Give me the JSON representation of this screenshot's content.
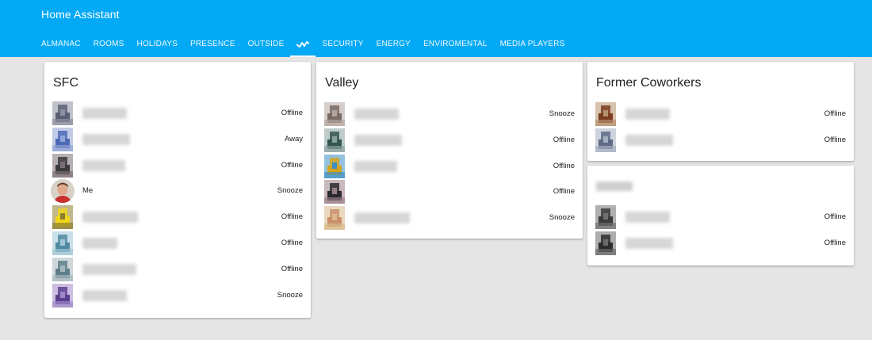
{
  "app": {
    "title": "Home Assistant"
  },
  "tabs": [
    {
      "label": "ALMANAC"
    },
    {
      "label": "ROOMS"
    },
    {
      "label": "HOLIDAYS"
    },
    {
      "label": "PRESENCE"
    },
    {
      "label": "OUTSIDE"
    },
    {
      "label": "",
      "icon": "wave-icon",
      "active": true
    },
    {
      "label": "SECURITY"
    },
    {
      "label": "ENERGY"
    },
    {
      "label": "ENVIROMENTAL"
    },
    {
      "label": "MEDIA PLAYERS"
    }
  ],
  "cards": {
    "sfc": {
      "title": "SFC",
      "people": [
        {
          "name": "",
          "status": "Offline",
          "colors": [
            "#5a5f74",
            "#8d8fa0"
          ]
        },
        {
          "name": "",
          "status": "Away",
          "colors": [
            "#4d6ab6",
            "#8fa3d6"
          ]
        },
        {
          "name": "",
          "status": "Offline",
          "colors": [
            "#3a3a3f",
            "#7c6f74"
          ]
        },
        {
          "name": "Me",
          "status": "Snooze",
          "photo": true
        },
        {
          "name": "",
          "status": "Offline",
          "colors": [
            "#f0d51b",
            "#8c7d2a"
          ]
        },
        {
          "name": "",
          "status": "Offline",
          "colors": [
            "#4f8aa0",
            "#9fc7d5"
          ]
        },
        {
          "name": "",
          "status": "Offline",
          "colors": [
            "#5f7f8a",
            "#a6b8bd"
          ]
        },
        {
          "name": "",
          "status": "Snooze",
          "colors": [
            "#5b3f8f",
            "#a088c7"
          ]
        }
      ]
    },
    "valley": {
      "title": "Valley",
      "people": [
        {
          "name": "",
          "status": "Snooze",
          "colors": [
            "#7a6a64",
            "#b3a69e"
          ]
        },
        {
          "name": "",
          "status": "Offline",
          "colors": [
            "#35554f",
            "#8aa3a0"
          ]
        },
        {
          "name": "",
          "status": "Offline",
          "colors": [
            "#d4a31f",
            "#3a8fc4"
          ]
        },
        {
          "name": "",
          "status": "Offline",
          "colors": [
            "#2a2a30",
            "#9a7f86"
          ]
        },
        {
          "name": "",
          "status": "Snooze",
          "colors": [
            "#c98f6b",
            "#d9b98a"
          ]
        }
      ]
    },
    "former": {
      "title": "Former Coworkers",
      "people": [
        {
          "name": "",
          "status": "Offline",
          "colors": [
            "#7a3c1f",
            "#b58f6e"
          ]
        },
        {
          "name": "",
          "status": "Offline",
          "colors": [
            "#5f6b86",
            "#a5afc2"
          ]
        }
      ]
    },
    "blurred": {
      "people": [
        {
          "name": "",
          "status": "Offline",
          "colors": [
            "#3a3a3a",
            "#707070"
          ]
        },
        {
          "name": "",
          "status": "Offline",
          "colors": [
            "#2e2e2e",
            "#6a6a6a"
          ]
        }
      ]
    }
  },
  "colors": {
    "header": "#03a9f4",
    "background": "#e5e5e5"
  }
}
